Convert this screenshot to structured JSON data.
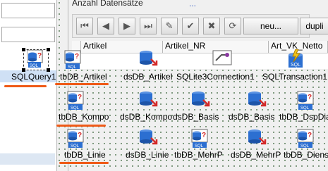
{
  "form": {
    "title": "Anzahl Datensätze",
    "title_suffix": "...",
    "nav_buttons": [
      {
        "name": "first-icon",
        "glyph": "⏮"
      },
      {
        "name": "prior-icon",
        "glyph": "◀"
      },
      {
        "name": "next-icon",
        "glyph": "▶"
      },
      {
        "name": "last-icon",
        "glyph": "⏭"
      },
      {
        "name": "edit-icon",
        "glyph": "✎"
      },
      {
        "name": "post-icon",
        "glyph": "✔"
      },
      {
        "name": "cancel-icon",
        "glyph": "✖"
      },
      {
        "name": "refresh-icon",
        "glyph": "⟳"
      }
    ],
    "new_button": "neu...",
    "dup_button": "dupli",
    "columns": [
      "Artikel",
      "Artikel_NR",
      "Art_VK_Netto"
    ]
  },
  "components": {
    "sqlquery_label": "SQLQuery1",
    "row1": [
      "tbDB_Artikel",
      "dsDB_Artikel",
      "SQLite3Connection1",
      "SQLTransaction1"
    ],
    "row2": [
      "tbDB_Kompo",
      "dsDB_Kompo",
      "dsDB_Basis",
      "dsDB_Basis",
      "tbDB_DspDiag"
    ],
    "row3": [
      "tbDB_Linie",
      "dsDB_Linie",
      "tbDB_MehrP",
      "dsDB_MehrP",
      "tbDB_DienstL"
    ]
  },
  "colors": {
    "underline": "#ef5a17",
    "selection": "#cfe0f5",
    "db_blue": "#2c6fd1",
    "db_yellow": "#f1c31a",
    "db_red": "#d32a2a"
  }
}
